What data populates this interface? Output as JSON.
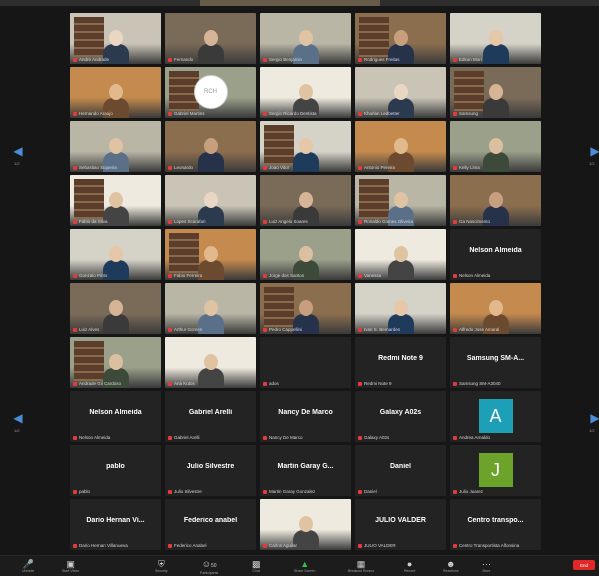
{
  "pagination": {
    "left_label": "1/2",
    "right_label": "1/2",
    "left_label_low": "1/2",
    "right_label_low": "1/2"
  },
  "tiles": [
    {
      "name": "Andre Andrade",
      "type": "video",
      "active": true
    },
    {
      "name": "Fernando",
      "type": "video"
    },
    {
      "name": "Sergio Benjamin",
      "type": "video"
    },
    {
      "name": "Rodrigues Freitas",
      "type": "video"
    },
    {
      "name": "Edson Mori",
      "type": "video"
    },
    {
      "name": "Hernando Araujo",
      "type": "video"
    },
    {
      "name": "Gabriel Martins",
      "type": "video",
      "logo": "RCH"
    },
    {
      "name": "Sergio Ricardo Dentista",
      "type": "video"
    },
    {
      "name": "Kharlan Ledbetter",
      "type": "video"
    },
    {
      "name": "Samsung",
      "type": "video"
    },
    {
      "name": "Sebastiao Siqueira",
      "type": "video"
    },
    {
      "name": "Leonardo",
      "type": "video"
    },
    {
      "name": "Joao Vitor",
      "type": "video"
    },
    {
      "name": "Antonio Pereira",
      "type": "video"
    },
    {
      "name": "Kelly Lima",
      "type": "video"
    },
    {
      "name": "Fabio da Silva",
      "type": "video"
    },
    {
      "name": "Lopes Scarafari",
      "type": "video"
    },
    {
      "name": "Luiz Angelo Soares",
      "type": "video"
    },
    {
      "name": "Ronaldo Gomes Oliveira",
      "type": "video"
    },
    {
      "name": "Ga Nascimento",
      "type": "video"
    },
    {
      "name": "Gonzalo Pinto",
      "type": "video"
    },
    {
      "name": "Fabio Ferreira",
      "type": "video"
    },
    {
      "name": "Jorge dos Santos",
      "type": "video"
    },
    {
      "name": "Vanessa",
      "type": "video"
    },
    {
      "name": "Nelson Almeida",
      "type": "name",
      "display": "Nelson Almeida"
    },
    {
      "name": "Luiz Alves",
      "type": "video"
    },
    {
      "name": "Arthur Gomes",
      "type": "video"
    },
    {
      "name": "Pedro Cappellini",
      "type": "video"
    },
    {
      "name": "Ivan S. Bernardes",
      "type": "video"
    },
    {
      "name": "Alfredo Jose Amaral",
      "type": "video"
    },
    {
      "name": "Andrade Gil Cardoso",
      "type": "video"
    },
    {
      "name": "Ana Kutos",
      "type": "video"
    },
    {
      "name": "ados",
      "type": "name",
      "display": ""
    },
    {
      "name": "Redmi Note 9",
      "type": "name",
      "display": "Redmi Note 9"
    },
    {
      "name": "Samsung SM-A3040",
      "type": "name",
      "display": "Samsung SM-A..."
    },
    {
      "name": "Nelson Almeida",
      "type": "name",
      "display": "Nelson Almeida"
    },
    {
      "name": "Gabriel Arelli",
      "type": "name",
      "display": "Gabriel Arelli"
    },
    {
      "name": "Nancy De Marco",
      "type": "name",
      "display": "Nancy De Marco"
    },
    {
      "name": "Galaxy A02s",
      "type": "name",
      "display": "Galaxy A02s"
    },
    {
      "name": "Andrea Arnaldo",
      "type": "avatar",
      "letter": "A",
      "color": "#1c9fb7"
    },
    {
      "name": "pablo",
      "type": "name",
      "display": "pablo"
    },
    {
      "name": "Julio Silvestre",
      "type": "name",
      "display": "Julio Silvestre"
    },
    {
      "name": "Martin Garay Gonzalez",
      "type": "name",
      "display": "Martin Garay G..."
    },
    {
      "name": "Daniel",
      "type": "name",
      "display": "Daniel"
    },
    {
      "name": "Julio Juarez",
      "type": "avatar",
      "letter": "J",
      "color": "#6ca42b"
    },
    {
      "name": "Dario Hernan Villanueva",
      "type": "name",
      "display": "Dario Hernan Vi..."
    },
    {
      "name": "Federico Anabel",
      "type": "name",
      "display": "Federico anabel"
    },
    {
      "name": "Carlos Aguilar",
      "type": "video"
    },
    {
      "name": "JULIO VALDER",
      "type": "name",
      "display": "JULIO VALDER"
    },
    {
      "name": "Centro Transportista Alfonsina",
      "type": "name",
      "display": "Centro transpo..."
    }
  ],
  "toolbar": {
    "mute": {
      "icon": "microphone-icon",
      "label": "Unmute"
    },
    "video": {
      "icon": "video-camera-icon",
      "label": "Start Video"
    },
    "security": {
      "icon": "shield-icon",
      "label": "Security"
    },
    "participants": {
      "icon": "participants-icon",
      "label": "Participants",
      "count": "50"
    },
    "chat": {
      "icon": "chat-icon",
      "label": "Chat"
    },
    "share": {
      "icon": "share-screen-icon",
      "label": "Share Screen"
    },
    "breakout": {
      "icon": "breakout-rooms-icon",
      "label": "Breakout Rooms"
    },
    "record": {
      "icon": "record-icon",
      "label": "Record"
    },
    "reactions": {
      "icon": "reactions-icon",
      "label": "Reactions"
    },
    "more": {
      "icon": "more-icon",
      "label": "More"
    },
    "end": {
      "label": "End"
    }
  }
}
